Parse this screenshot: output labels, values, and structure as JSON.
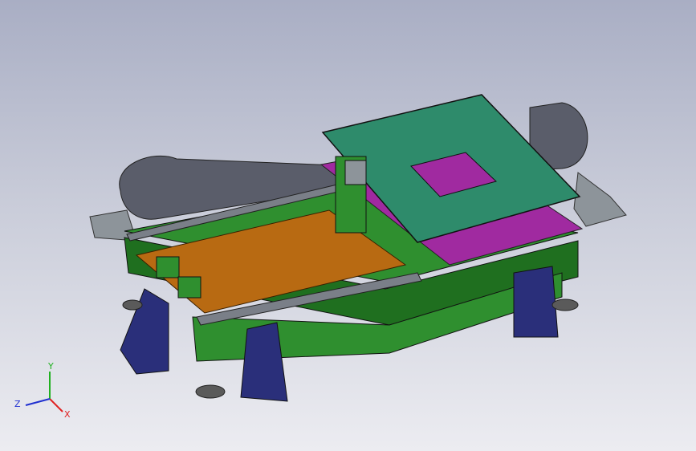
{
  "view": {
    "background_top": "#a9aec4",
    "background_bottom": "#ececf1"
  },
  "triad": {
    "x_label": "X",
    "y_label": "Y",
    "z_label": "Z",
    "x_color": "#e02020",
    "y_color": "#20b020",
    "z_color": "#2030d0"
  },
  "colors": {
    "frame": "#2f8f2f",
    "frame_dark": "#1f6f1f",
    "bed": "#b86a12",
    "top_plate": "#2e8b6b",
    "purple_plate": "#a02aa0",
    "rail": "#7a7f88",
    "cable_chain": "#5a5d6a",
    "bracket": "#2a2f7a",
    "foot": "#5a5a5a",
    "base_plate": "#8d949a"
  }
}
